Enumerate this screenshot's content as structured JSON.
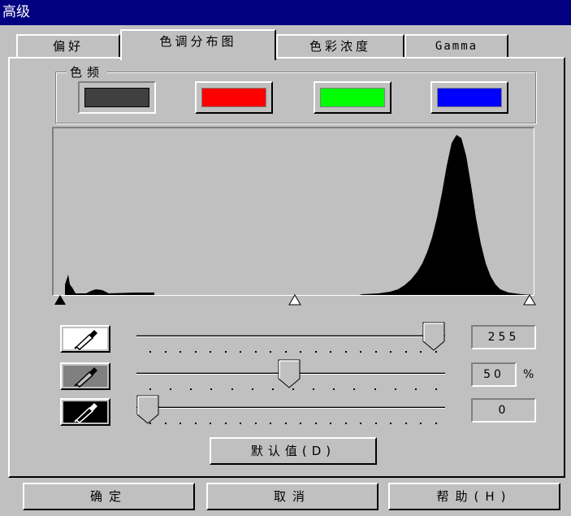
{
  "window": {
    "title": "高级"
  },
  "tabs": [
    {
      "label": "偏好",
      "active": false
    },
    {
      "label": "色调分布图",
      "active": true
    },
    {
      "label": "色彩浓度",
      "active": false
    },
    {
      "label": "Gamma",
      "active": false
    }
  ],
  "channel_group": {
    "label": "色频",
    "swatches": [
      {
        "name": "gray",
        "color": "#404040"
      },
      {
        "name": "red",
        "color": "#ff0000"
      },
      {
        "name": "green",
        "color": "#00ff00"
      },
      {
        "name": "blue",
        "color": "#0000ff"
      }
    ]
  },
  "sliders": {
    "highlight": {
      "value": "255",
      "unit": ""
    },
    "midtone": {
      "value": "50",
      "unit": "%"
    },
    "shadow": {
      "value": "0",
      "unit": ""
    }
  },
  "buttons": {
    "default": "默认值(D)",
    "ok": "确定",
    "cancel": "取消",
    "help": "帮助(H)"
  }
}
